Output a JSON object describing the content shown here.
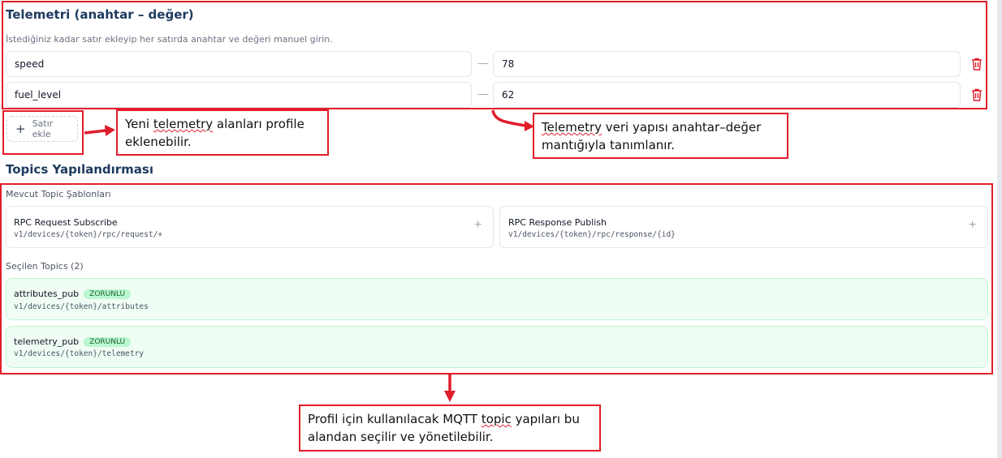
{
  "telemetry": {
    "title": "Telemetri (anahtar – değer)",
    "hint": "İstediğiniz kadar satır ekleyip her satırda anahtar ve değeri manuel girin.",
    "separator": "—",
    "rows": [
      {
        "key": "speed",
        "value": "78"
      },
      {
        "key": "fuel_level",
        "value": "62"
      }
    ],
    "add_row_label": "Satır ekle"
  },
  "topics": {
    "title": "Topics Yapılandırması",
    "templates_label": "Mevcut Topic Şablonları",
    "templates": [
      {
        "name": "RPC Request Subscribe",
        "path": "v1/devices/{token}/rpc/request/+"
      },
      {
        "name": "RPC Response Publish",
        "path": "v1/devices/{token}/rpc/response/{id}"
      }
    ],
    "selected_label": "Seçilen Topics (2)",
    "selected": [
      {
        "name": "attributes_pub",
        "badge": "ZORUNLU",
        "path": "v1/devices/{token}/attributes"
      },
      {
        "name": "telemetry_pub",
        "badge": "ZORUNLU",
        "path": "v1/devices/{token}/telemetry"
      }
    ]
  },
  "annotations": {
    "add_row": {
      "pre": "Yeni ",
      "marked": "telemetry",
      "post": " alanları profile eklenebilir."
    },
    "structure": {
      "pre": "",
      "marked": "Telemetry",
      "post": " veri yapısı anahtar–değer mantığıyla tanımlanır."
    },
    "topics": {
      "pre": "Profil için kullanılacak MQTT ",
      "marked": "topic",
      "post": " yapıları bu alandan seçilir ve yönetilebilir."
    }
  },
  "colors": {
    "annotation_red": "#e11d2a",
    "title_navy": "#1e3a5f",
    "selected_green_bg": "#f0fdf4",
    "badge_green": "#bbf7d0"
  }
}
